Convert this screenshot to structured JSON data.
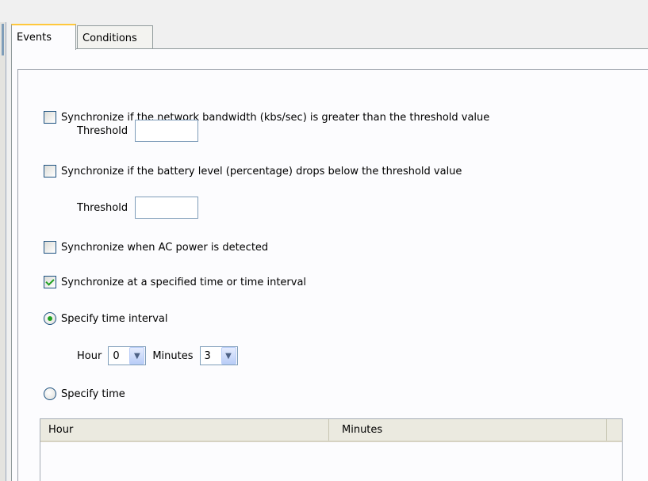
{
  "tabs": [
    {
      "label": "Events",
      "active": true
    },
    {
      "label": "Conditions",
      "active": false
    }
  ],
  "events": {
    "bandwidth": {
      "label": "Synchronize if the network bandwidth (kbs/sec) is greater than the threshold value",
      "checked": false,
      "threshold_label": "Threshold",
      "threshold_value": ""
    },
    "battery": {
      "label": "Synchronize if the battery level (percentage) drops below the threshold value",
      "checked": false,
      "threshold_label": "Threshold",
      "threshold_value": ""
    },
    "ac_power": {
      "label": "Synchronize when AC power is detected",
      "checked": false
    },
    "scheduled": {
      "label": "Synchronize at a specified time or time interval",
      "checked": true
    },
    "interval": {
      "label": "Specify time interval",
      "selected": true,
      "hour_label": "Hour",
      "hour_value": "0",
      "minutes_label": "Minutes",
      "minutes_value": "3"
    },
    "time": {
      "label": "Specify time",
      "selected": false
    }
  },
  "time_table": {
    "columns": [
      "Hour",
      "Minutes"
    ],
    "rows": []
  },
  "colors": {
    "check_accent": "#21a121",
    "active_tab_accent": "#ffc83c",
    "control_border": "#1c5180"
  },
  "icons": {
    "combo_arrow": "chevron-down-icon"
  }
}
